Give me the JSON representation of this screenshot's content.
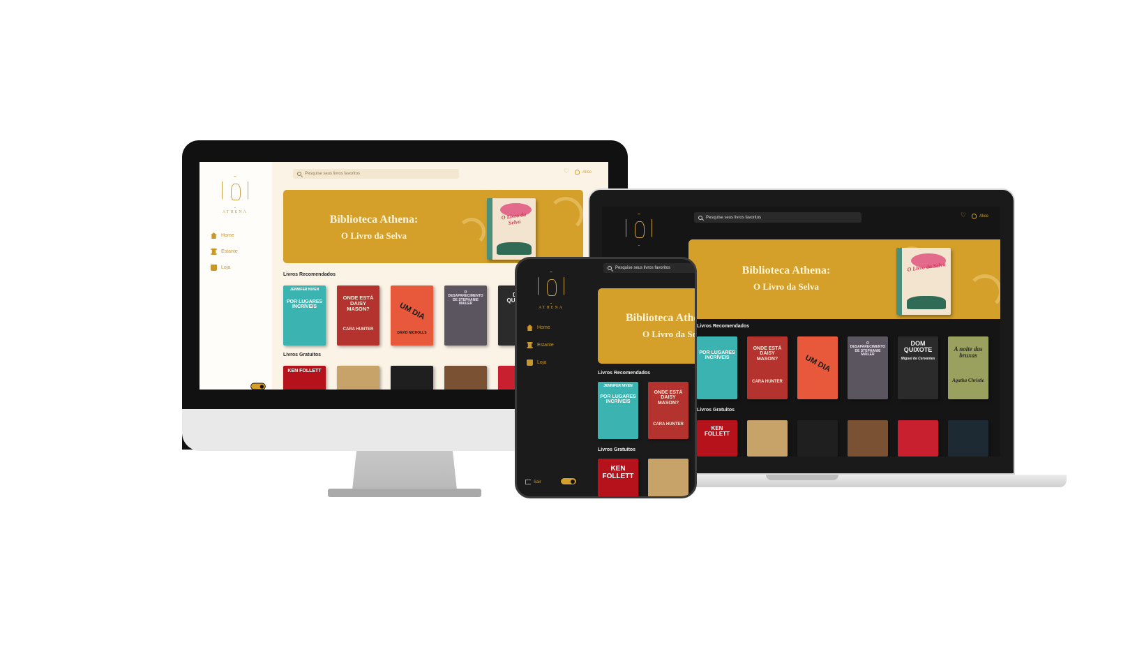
{
  "app": {
    "brand": "ATHENA",
    "search_placeholder": "Pesquise seus livros favoritos",
    "user_name": "Alice",
    "nav": [
      {
        "label": "Home",
        "icon": "home-icon"
      },
      {
        "label": "Estante",
        "icon": "bookshelf-icon"
      },
      {
        "label": "Loja",
        "icon": "shopping-bag-icon"
      }
    ],
    "logout_label": "Sair",
    "banner": {
      "title": "Biblioteca Athena:",
      "subtitle": "O Livro da Selva",
      "featured_cover_title": "O Livro da Selva"
    },
    "sections": {
      "recommended": "Livros Recomendados",
      "free": "Livros Gratuitos"
    },
    "colors": {
      "accent": "#d4a02a",
      "light_bg": "#fbf3e6",
      "dark_bg": "#151515"
    }
  },
  "recommended_books": [
    {
      "title": "POR LUGARES INCRÍVEIS",
      "author": "JENNIFER NIVEN",
      "bg": "#3bb3b0",
      "fg": "#ffffff"
    },
    {
      "title": "ONDE ESTÁ DAISY MASON?",
      "author": "CARA HUNTER",
      "bg": "#b5332f",
      "fg": "#f6e8d8"
    },
    {
      "title": "UM DIA",
      "author": "DAVID NICHOLLS",
      "bg": "#e8583a",
      "fg": "#1a1a1a"
    },
    {
      "title": "O DESAPARECIMENTO DE STEPHANIE MAILER",
      "author": "",
      "bg": "#5b5560",
      "fg": "#efe6f5"
    },
    {
      "title": "DOM QUIXOTE",
      "author": "Miguel de Cervantes",
      "bg": "#2b2b2b",
      "fg": "#f2f2f2"
    },
    {
      "title": "A noite das bruxas",
      "author": "Agatha Christie",
      "bg": "#9aa15e",
      "fg": "#2a2a22"
    }
  ],
  "free_books": [
    {
      "title": "KEN FOLLETT",
      "bg": "#b5121b",
      "fg": "#ffffff"
    },
    {
      "title": "",
      "bg": "#c7a36a",
      "fg": "#2b3e2a"
    },
    {
      "title": "",
      "bg": "#1f1f1f",
      "fg": "#dddddd"
    },
    {
      "title": "",
      "bg": "#7a5233",
      "fg": "#f3d9b8"
    },
    {
      "title": "",
      "bg": "#c8202f",
      "fg": "#ffffff"
    },
    {
      "title": "",
      "bg": "#1e2a33",
      "fg": "#cfd9e0"
    }
  ]
}
